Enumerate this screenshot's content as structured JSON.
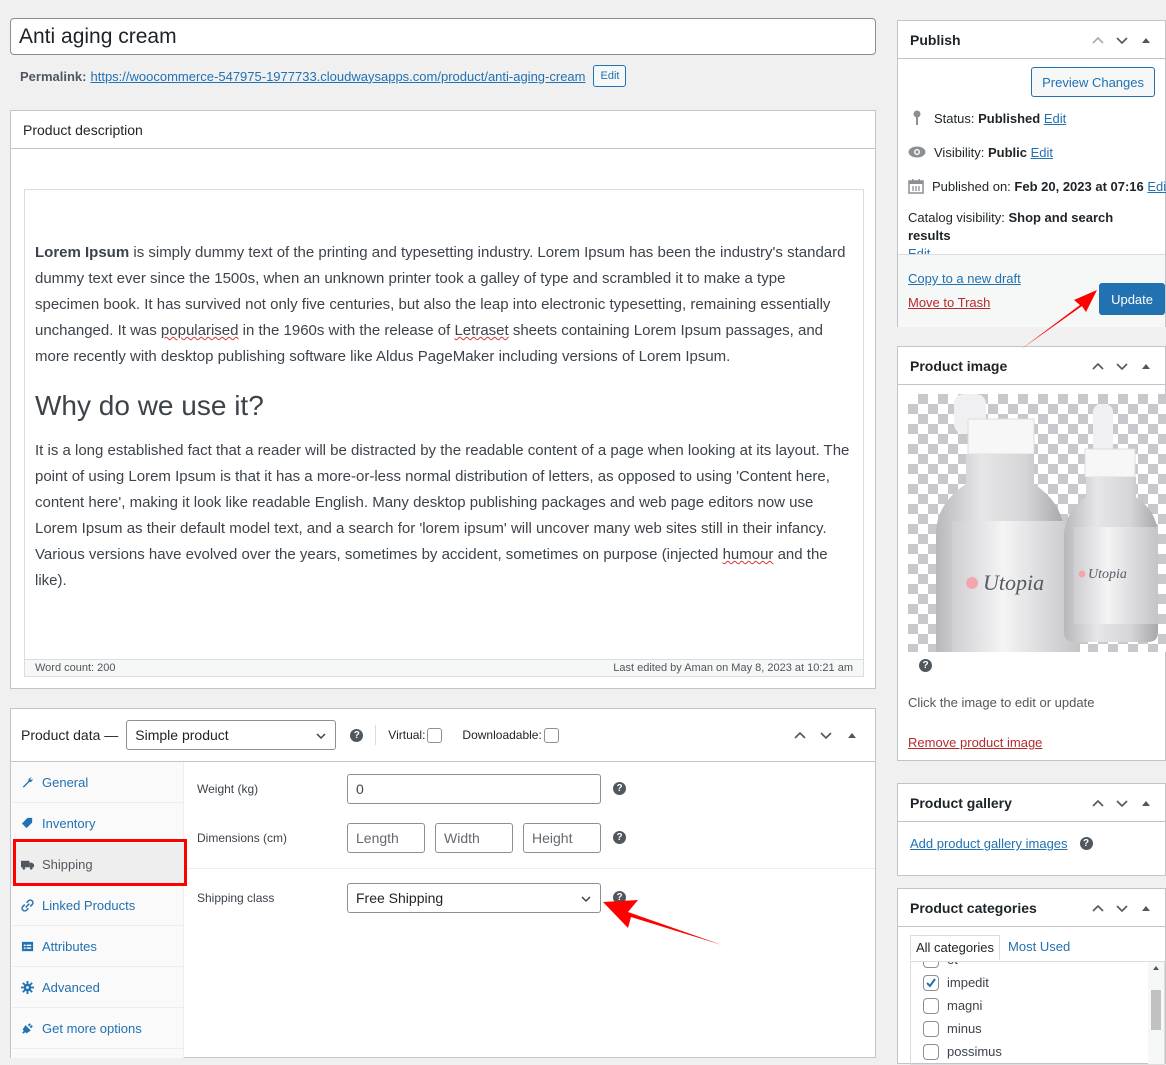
{
  "post": {
    "title": "Anti aging cream",
    "permalink_label": "Permalink:",
    "permalink_base": "https://woocommerce-547975-1977733.cloudwaysapps.com/product/",
    "permalink_slug": "anti-aging-cream",
    "permalink_edit": "Edit"
  },
  "description": {
    "box_title": "Product description",
    "p1_bold": "Lorem Ipsum",
    "p1_a": " is simply dummy text of the printing and typesetting industry. Lorem Ipsum has been the industry's standard dummy text ever since the 1500s, when an unknown printer took a galley of type and scrambled it to make a type specimen book. It has survived not only five centuries, but also the leap into electronic typesetting, remaining essentially unchanged. It was ",
    "p1_sq1": "popularised",
    "p1_b": " in the 1960s with the release of ",
    "p1_sq2": "Letraset",
    "p1_c": " sheets containing Lorem Ipsum passages, and more recently with desktop publishing software like Aldus PageMaker including versions of Lorem Ipsum.",
    "heading": "Why do we use it?",
    "p2_a": "It is a long established fact that a reader will be distracted by the readable content of a page when looking at its layout. The point of using Lorem Ipsum is that it has a more-or-less normal distribution of letters, as opposed to using 'Content here, content here', making it look like readable English. Many desktop publishing packages and web page editors now use Lorem Ipsum as their default model text, and a search for 'lorem ipsum' will uncover many web sites still in their infancy. Various versions have evolved over the years, sometimes by accident, sometimes on purpose (injected ",
    "p2_sq": "humour",
    "p2_b": " and the like).",
    "word_count": "Word count: 200",
    "last_edited": "Last edited by Aman on May 8, 2023 at 10:21 am"
  },
  "product_data": {
    "label": "Product data —",
    "type_selected": "Simple product",
    "virtual_label": "Virtual:",
    "downloadable_label": "Downloadable:",
    "tabs": [
      {
        "label": "General",
        "icon": "wrench-icon"
      },
      {
        "label": "Inventory",
        "icon": "tag-icon"
      },
      {
        "label": "Shipping",
        "icon": "truck-icon",
        "active": true
      },
      {
        "label": "Linked Products",
        "icon": "link-icon"
      },
      {
        "label": "Attributes",
        "icon": "list-icon"
      },
      {
        "label": "Advanced",
        "icon": "gear-icon"
      },
      {
        "label": "Get more options",
        "icon": "plugin-icon"
      }
    ],
    "shipping": {
      "weight_label": "Weight (kg)",
      "weight_value": "0",
      "dimensions_label": "Dimensions (cm)",
      "length_placeholder": "Length",
      "width_placeholder": "Width",
      "height_placeholder": "Height",
      "class_label": "Shipping class",
      "class_selected": "Free Shipping"
    }
  },
  "publish": {
    "title": "Publish",
    "preview": "Preview Changes",
    "status_label": "Status:",
    "status_value": "Published",
    "visibility_label": "Visibility:",
    "visibility_value": "Public",
    "published_label": "Published on:",
    "published_value": "Feb 20, 2023 at 07:16",
    "catalog_label": "Catalog visibility:",
    "catalog_value": "Shop and search results",
    "edit": "Edit",
    "copy_draft": "Copy to a new draft",
    "trash": "Move to Trash",
    "update": "Update"
  },
  "product_image": {
    "title": "Product image",
    "brand_text": "Utopia",
    "hint": "Click the image to edit or update",
    "remove": "Remove product image"
  },
  "gallery": {
    "title": "Product gallery",
    "add": "Add product gallery images"
  },
  "categories": {
    "title": "Product categories",
    "tab_all": "All categories",
    "tab_most": "Most Used",
    "items": [
      {
        "label": "et",
        "checked": false
      },
      {
        "label": "impedit",
        "checked": true
      },
      {
        "label": "magni",
        "checked": false
      },
      {
        "label": "minus",
        "checked": false
      },
      {
        "label": "possimus",
        "checked": false
      }
    ]
  },
  "colors": {
    "accent": "#2271b1",
    "danger": "#b32d2e",
    "annotation": "#ff0000"
  }
}
